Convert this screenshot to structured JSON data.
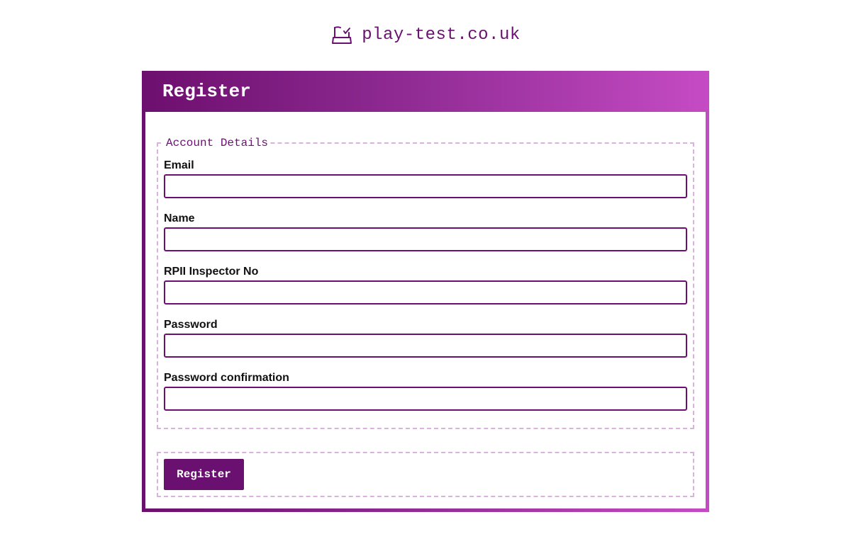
{
  "brand": {
    "name": "play-test.co.uk",
    "icon": "swing-checkmark-icon",
    "color": "#6a1070"
  },
  "card": {
    "title": "Register"
  },
  "account_details": {
    "legend": "Account Details",
    "fields": [
      {
        "label": "Email",
        "value": "",
        "placeholder": ""
      },
      {
        "label": "Name",
        "value": "",
        "placeholder": ""
      },
      {
        "label": "RPII Inspector No",
        "value": "",
        "placeholder": ""
      },
      {
        "label": "Password",
        "value": "",
        "placeholder": ""
      },
      {
        "label": "Password confirmation",
        "value": "",
        "placeholder": ""
      }
    ]
  },
  "actions": {
    "submit_label": "Register"
  },
  "colors": {
    "accent": "#6a1070",
    "gradient_start": "#6d0f6e",
    "gradient_end": "#c54bc4",
    "dashed_border": "#d9b3de"
  }
}
